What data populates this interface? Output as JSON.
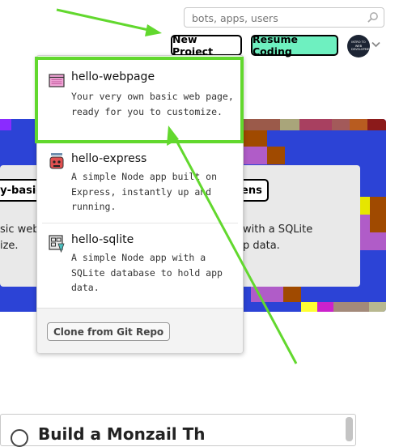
{
  "search": {
    "placeholder": "bots, apps, users",
    "icon": "search-icon"
  },
  "header": {
    "new_project_label": "New Project",
    "resume_coding_label": "Resume Coding",
    "avatar_text": "INTRO TO WEB DEVELOPMENT",
    "colors": {
      "resume_bg": "#6ef0c0",
      "highlight": "#62d82e"
    }
  },
  "dropdown": {
    "items": [
      {
        "title": "hello-webpage",
        "description": "Your very own basic web page, ready for you to customize.",
        "icon": "webpage-icon"
      },
      {
        "title": "hello-express",
        "description": "A simple Node app built on Express, instantly up and running.",
        "icon": "express-icon"
      },
      {
        "title": "hello-sqlite",
        "description": "A simple Node app with a SQLite database to hold app data.",
        "icon": "sqlite-icon"
      }
    ],
    "clone_label": "Clone from Git Repo"
  },
  "background": {
    "left_pill": "y-basic",
    "left_text_1": "sic web",
    "left_text_2": "ize.",
    "right_pill": "ens",
    "right_text_1": "with a SQLite",
    "right_text_2": "p data."
  },
  "bottom": {
    "title": "Build a Monzail Th"
  }
}
